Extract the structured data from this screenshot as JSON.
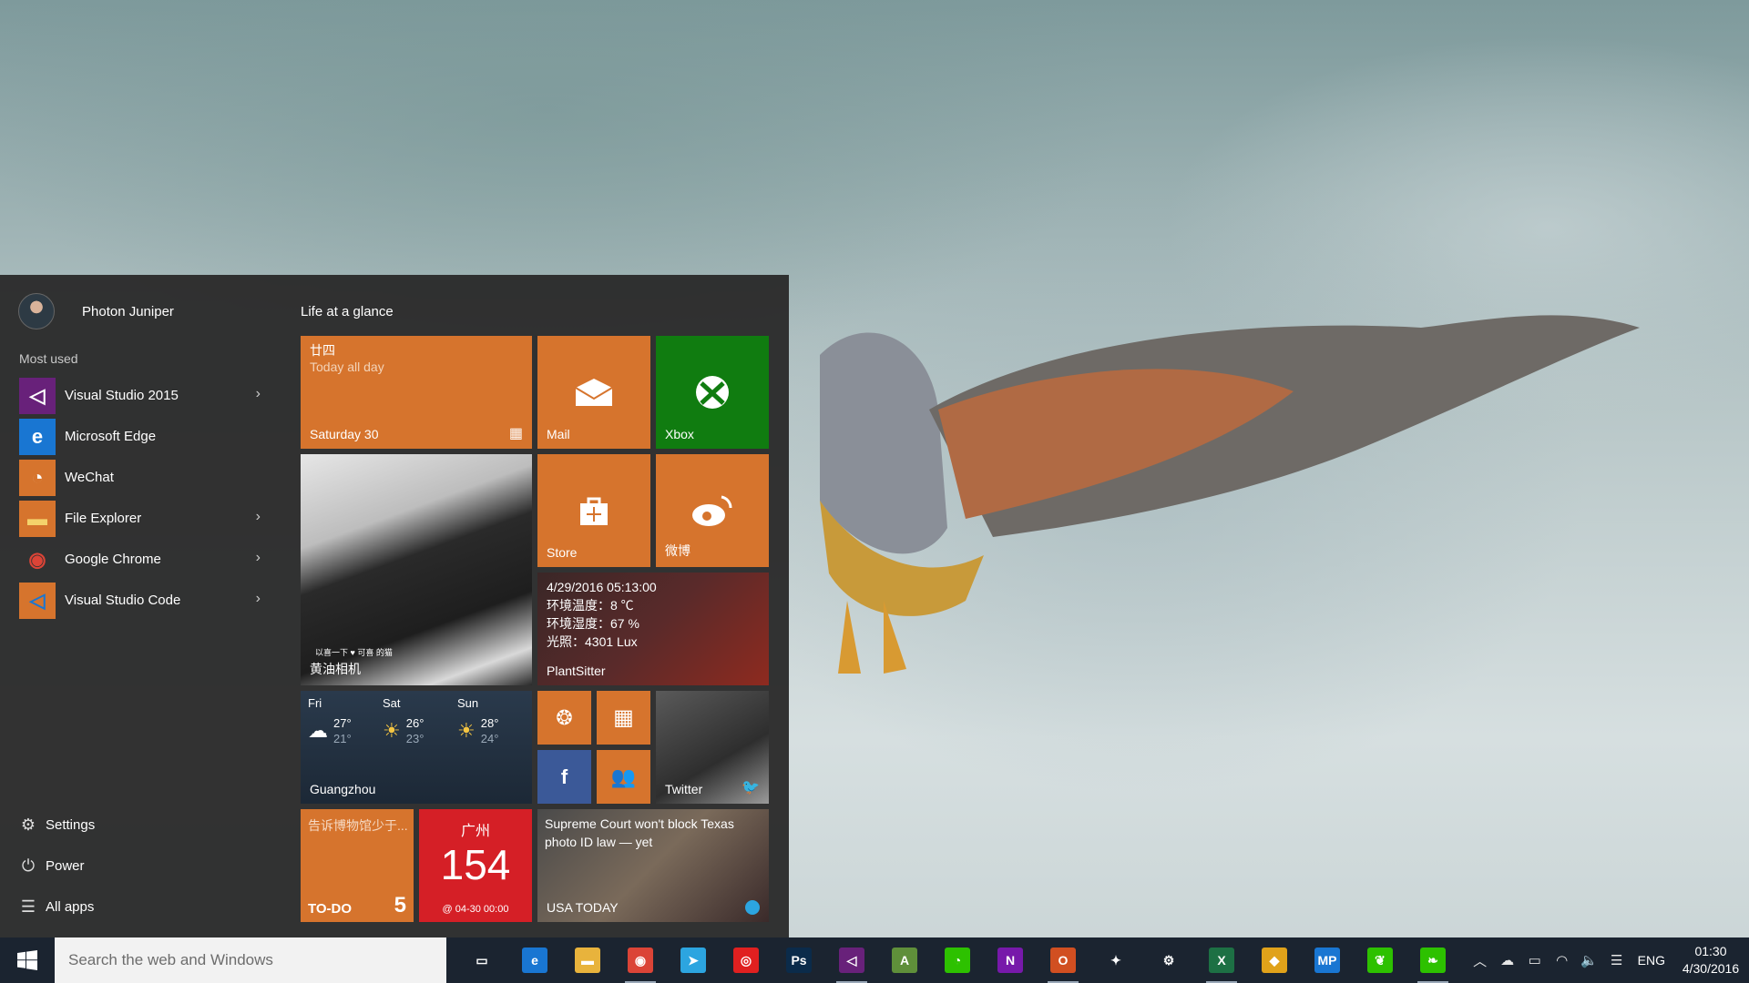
{
  "user": {
    "name": "Photon Juniper"
  },
  "most_used": {
    "title": "Most used",
    "items": [
      {
        "label": "Visual Studio 2015",
        "icon": "visual-studio-icon",
        "color": "#68217a",
        "has_submenu": true
      },
      {
        "label": "Microsoft Edge",
        "icon": "edge-icon",
        "color": "#1976d2",
        "has_submenu": false
      },
      {
        "label": "WeChat",
        "icon": "wechat-icon",
        "color": "#d6742d",
        "has_submenu": false
      },
      {
        "label": "File Explorer",
        "icon": "file-explorer-icon",
        "color": "#d6742d",
        "has_submenu": true
      },
      {
        "label": "Google Chrome",
        "icon": "chrome-icon",
        "color": "#2b2b2b",
        "has_submenu": true
      },
      {
        "label": "Visual Studio Code",
        "icon": "vscode-icon",
        "color": "#d6742d",
        "has_submenu": true
      }
    ]
  },
  "bottom": {
    "settings": "Settings",
    "power": "Power",
    "all_apps": "All apps"
  },
  "tiles": {
    "group_title": "Life at a glance",
    "calendar": {
      "lunar": "廿四",
      "event": "Today all day",
      "date": "Saturday 30"
    },
    "mail": "Mail",
    "xbox": "Xbox",
    "store": "Store",
    "weibo": "微博",
    "photo_app": {
      "label": "黄油相机",
      "caption": "以喜一下 ♥ 可喜 的猫"
    },
    "plantsitter": {
      "label": "PlantSitter",
      "lines": [
        "4/29/2016 05:13:00",
        "环境温度：8 ℃",
        "环境湿度：67 %",
        "光照：4301 Lux"
      ]
    },
    "weather": {
      "location": "Guangzhou",
      "days": [
        {
          "day": "Fri",
          "high": "27°",
          "low": "21°"
        },
        {
          "day": "Sat",
          "high": "26°",
          "low": "23°"
        },
        {
          "day": "Sun",
          "high": "28°",
          "low": "24°"
        }
      ]
    },
    "twitter": "Twitter",
    "todo": {
      "task": "告诉博物馆少于...",
      "label": "TO-DO",
      "count": "5"
    },
    "air": {
      "city": "广州",
      "value": "154",
      "time": "@ 04-30 00:00"
    },
    "news": {
      "headline": "Supreme Court won't block Texas photo ID law — yet",
      "source": "USA TODAY"
    }
  },
  "taskbar": {
    "search_placeholder": "Search the web and Windows",
    "pinned": [
      {
        "name": "task-view-icon",
        "glyph": "▭",
        "color": "transparent",
        "running": false
      },
      {
        "name": "edge-icon",
        "glyph": "e",
        "color": "#1976d2",
        "running": false
      },
      {
        "name": "file-explorer-icon",
        "glyph": "▬",
        "color": "#e8b33c",
        "running": false
      },
      {
        "name": "chrome-icon",
        "glyph": "◉",
        "color": "#db4437",
        "running": true
      },
      {
        "name": "telegram-icon",
        "glyph": "➤",
        "color": "#2ca5e0",
        "running": false
      },
      {
        "name": "netease-music-icon",
        "glyph": "◎",
        "color": "#e02020",
        "running": false
      },
      {
        "name": "photoshop-icon",
        "glyph": "Ps",
        "color": "#0b2b4a",
        "running": false
      },
      {
        "name": "visual-studio-icon",
        "glyph": "◁",
        "color": "#68217a",
        "running": true
      },
      {
        "name": "android-studio-icon",
        "glyph": "A",
        "color": "#5f8f3a",
        "running": false
      },
      {
        "name": "wechat-icon",
        "glyph": "◔",
        "color": "#2dc100",
        "running": false
      },
      {
        "name": "onenote-icon",
        "glyph": "N",
        "color": "#7719aa",
        "running": false
      },
      {
        "name": "office-icon",
        "glyph": "O",
        "color": "#d14f21",
        "running": true
      },
      {
        "name": "idea-icon",
        "glyph": "✦",
        "color": "transparent",
        "running": false
      },
      {
        "name": "settings-icon",
        "glyph": "⚙",
        "color": "transparent",
        "running": false
      },
      {
        "name": "excel-icon",
        "glyph": "X",
        "color": "#1d7044",
        "running": true
      },
      {
        "name": "git-icon",
        "glyph": "◆",
        "color": "#e0a21a",
        "running": false
      },
      {
        "name": "mp-icon",
        "glyph": "MP",
        "color": "#1976d2",
        "running": false
      },
      {
        "name": "leaf-icon",
        "glyph": "❦",
        "color": "#2dc100",
        "running": false
      },
      {
        "name": "feather-icon",
        "glyph": "❧",
        "color": "#2dc100",
        "running": true
      }
    ],
    "language": "ENG",
    "time": "01:30",
    "date": "4/30/2016"
  }
}
